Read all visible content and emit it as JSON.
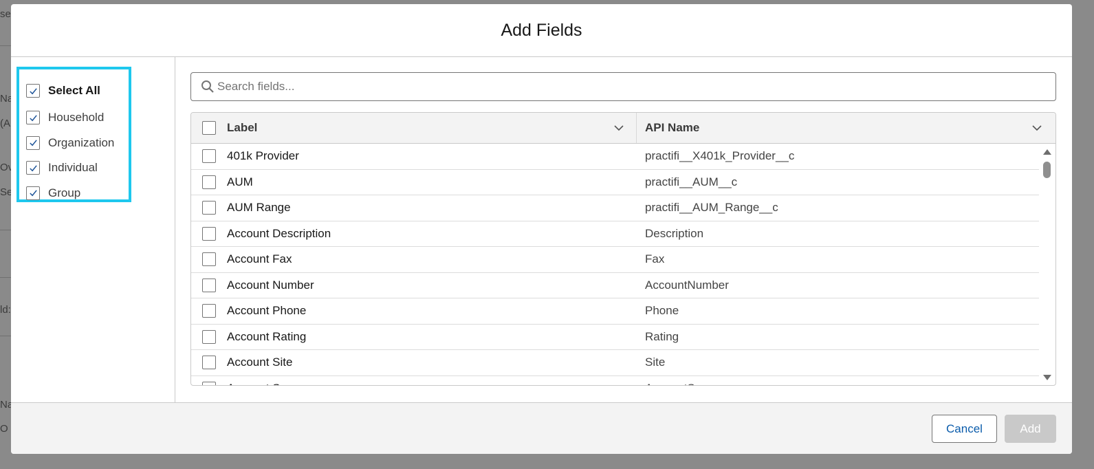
{
  "background": {
    "fragments": [
      "se",
      "Na",
      "(A",
      "Ov",
      "Se",
      "ld:",
      "Na",
      "O"
    ]
  },
  "modal": {
    "title": "Add Fields"
  },
  "record_types": {
    "select_all": {
      "label": "Select All",
      "checked": true
    },
    "items": [
      {
        "label": "Household",
        "checked": true
      },
      {
        "label": "Organization",
        "checked": true
      },
      {
        "label": "Individual",
        "checked": true
      },
      {
        "label": "Group",
        "checked": true
      }
    ]
  },
  "search": {
    "placeholder": "Search fields...",
    "value": ""
  },
  "table": {
    "columns": [
      "Label",
      "API Name"
    ],
    "rows": [
      {
        "label": "401k Provider",
        "api": "practifi__X401k_Provider__c"
      },
      {
        "label": "AUM",
        "api": "practifi__AUM__c"
      },
      {
        "label": "AUM Range",
        "api": "practifi__AUM_Range__c"
      },
      {
        "label": "Account Description",
        "api": "Description"
      },
      {
        "label": "Account Fax",
        "api": "Fax"
      },
      {
        "label": "Account Number",
        "api": "AccountNumber"
      },
      {
        "label": "Account Phone",
        "api": "Phone"
      },
      {
        "label": "Account Rating",
        "api": "Rating"
      },
      {
        "label": "Account Site",
        "api": "Site"
      },
      {
        "label": "Account Source",
        "api": "AccountSource"
      }
    ]
  },
  "footer": {
    "cancel_label": "Cancel",
    "add_label": "Add"
  },
  "colors": {
    "highlight": "#1ec8ee",
    "link": "#0b5cab",
    "disabled": "#c9c9c9"
  }
}
